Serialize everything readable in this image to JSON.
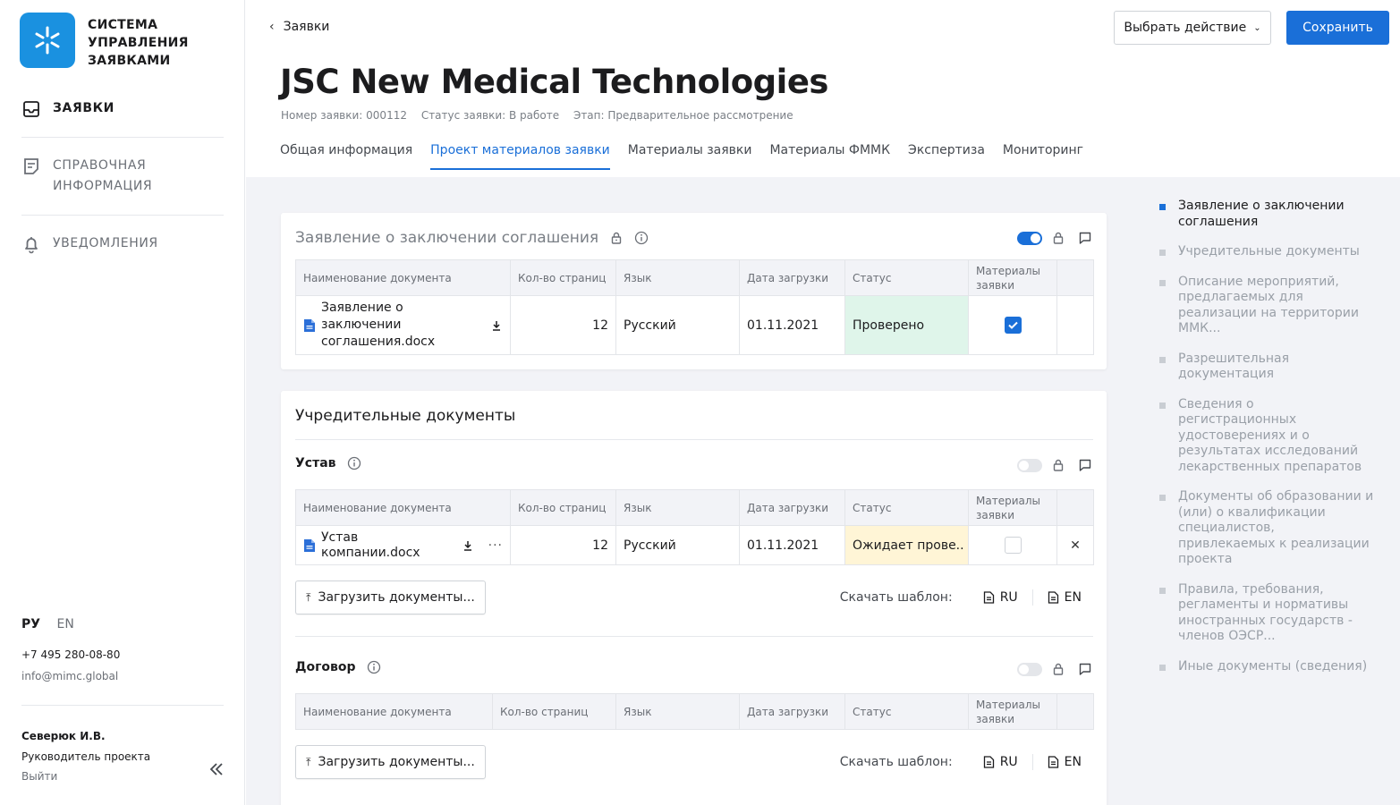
{
  "app": {
    "brand": [
      "СИСТЕМА",
      "УПРАВЛЕНИЯ",
      "ЗАЯВКАМИ"
    ]
  },
  "sidebar": {
    "items": [
      {
        "label": "ЗАЯВКИ",
        "icon": "inbox-icon",
        "active": true
      },
      {
        "label": "СПРАВОЧНАЯ ИНФОРМАЦИЯ",
        "icon": "document-icon",
        "active": false
      },
      {
        "label": "УВЕДОМЛЕНИЯ",
        "icon": "bell-icon",
        "active": false
      }
    ],
    "languages": {
      "current": "РУ",
      "other": "EN"
    },
    "phone": "+7 495 280-08-80",
    "email": "info@mimc.global",
    "user": {
      "name": "Северюк И.В.",
      "role": "Руководитель проекта",
      "logout": "Выйти"
    }
  },
  "header": {
    "back_label": "Заявки",
    "action_label": "Выбрать действие",
    "save_label": "Сохранить",
    "title": "JSC New Medical Technologies",
    "meta": {
      "number": "Номер заявки: 000112",
      "status": "Статус заявки: В работе",
      "stage": "Этап: Предварительное рассмотрение"
    },
    "tabs": [
      {
        "label": "Общая информация",
        "active": false
      },
      {
        "label": "Проект материалов заявки",
        "active": true
      },
      {
        "label": "Материалы заявки",
        "active": false
      },
      {
        "label": "Материалы ФММК",
        "active": false
      },
      {
        "label": "Экспертиза",
        "active": false
      },
      {
        "label": "Мониторинг",
        "active": false
      }
    ]
  },
  "columns": {
    "name": "Наименование документа",
    "pages": "Кол-во страниц",
    "language": "Язык",
    "date": "Дата загрузки",
    "status": "Статус",
    "materials": "Материалы заявки"
  },
  "card1": {
    "title": "Заявление о заключении соглашения",
    "toggle_on": true,
    "rows": [
      {
        "name": "Заявление о заключении соглашения.docx",
        "pages": "12",
        "language": "Русский",
        "date": "01.11.2021",
        "status": "Проверено",
        "checked": true
      }
    ]
  },
  "card2": {
    "title": "Учредительные документы",
    "sections": [
      {
        "title": "Устав",
        "toggle_on": false,
        "rows": [
          {
            "name": "Устав компании.docx",
            "pages": "12",
            "language": "Русский",
            "date": "01.11.2021",
            "status": "Ожидает прове..",
            "checked": false
          }
        ]
      },
      {
        "title": "Договор",
        "toggle_on": false,
        "rows": []
      }
    ],
    "upload_label": "Загрузить документы...",
    "template_label": "Скачать шаблон:",
    "template_ru": "RU",
    "template_en": "EN"
  },
  "anchors": [
    {
      "label": "Заявление о заключении соглашения",
      "active": true
    },
    {
      "label": "Учредительные документы",
      "active": false
    },
    {
      "label": "Описание мероприятий, предлагаемых для реализации на территории ММК...",
      "active": false
    },
    {
      "label": "Разрешительная документация",
      "active": false
    },
    {
      "label": "Сведения о регистрационных удостоверениях и о результатах исследований лекарственных препаратов",
      "active": false
    },
    {
      "label": "Документы об образовании и (или) о квалификации специалистов, привлекаемых к реализации проекта",
      "active": false
    },
    {
      "label": "Правила, требования, регламенты и нормативы иностранных государств - членов ОЭСР...",
      "active": false
    },
    {
      "label": "Иные документы (сведения)",
      "active": false
    }
  ],
  "colors": {
    "accent": "#1a6fd8",
    "brand": "#1a91e0",
    "ok": "#dff5ea",
    "wait": "#fff5d6"
  }
}
